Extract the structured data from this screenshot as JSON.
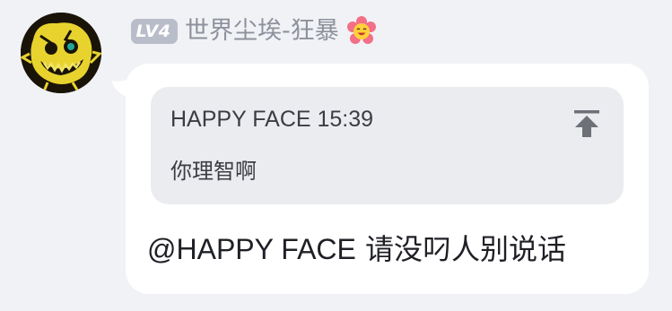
{
  "sender": {
    "avatar_icon": "yellow-monster-face-avatar",
    "level_badge": "LV4",
    "name": "世界尘埃-狂暴",
    "name_icon": "flower-smiley-icon"
  },
  "message": {
    "quote": {
      "author": "HAPPY FACE",
      "time": "15:39",
      "text": "你理智啊",
      "jump_icon": "scroll-to-top-icon"
    },
    "mention": "@HAPPY FACE",
    "text": " 请没叼人别说话"
  },
  "colors": {
    "background": "#f1f2f6",
    "bubble": "#ffffff",
    "quote_background": "#ebecef",
    "badge": "#b9bdc9",
    "username": "#8e919c"
  }
}
